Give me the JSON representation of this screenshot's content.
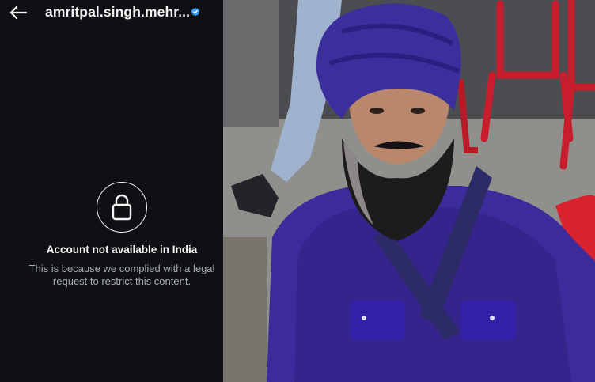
{
  "header": {
    "username": "amritpal.singh.mehr...",
    "back_icon": "arrow-left-icon",
    "verified_icon": "verified-badge-icon"
  },
  "restriction": {
    "lock_icon": "lock-icon",
    "title": "Account not available in India",
    "message": "This is because we complied with a legal request to restrict this content."
  },
  "photo": {
    "description_icon": "profile-photo"
  },
  "colors": {
    "background": "#0e1013",
    "verified": "#3897f0",
    "text_primary": "#f5f5f5",
    "text_secondary": "#a8abb0"
  }
}
